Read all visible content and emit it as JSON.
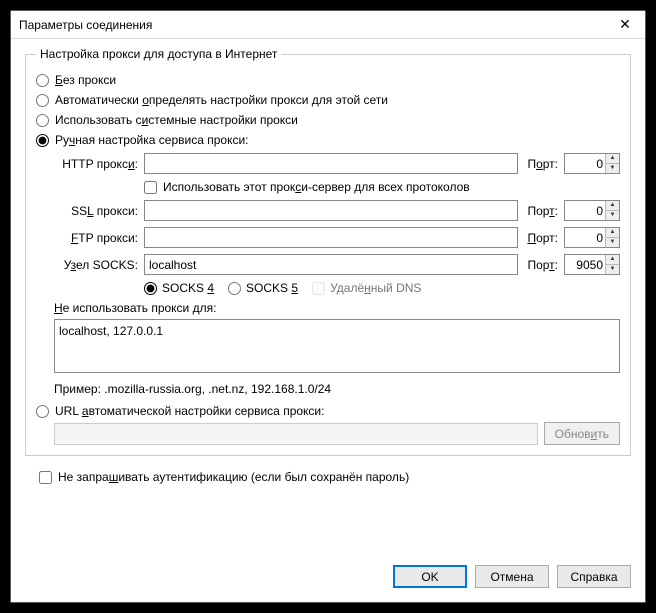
{
  "window": {
    "title": "Параметры соединения"
  },
  "group": {
    "legend": "Настройка прокси для доступа в Интернет"
  },
  "radios": {
    "none_pre": "",
    "none_u": "Б",
    "none_post": "ез прокси",
    "auto_pre": "Автоматически ",
    "auto_u": "о",
    "auto_post": "пределять настройки прокси для этой сети",
    "sys_pre": "Использовать с",
    "sys_u": "и",
    "sys_post": "стемные настройки прокси",
    "manual_pre": "Ру",
    "manual_u": "ч",
    "manual_post": "ная настройка сервиса прокси:"
  },
  "labels": {
    "http_pre": "HTTP прокс",
    "http_u": "и",
    "http_post": ":",
    "ssl_pre": "SS",
    "ssl_u": "L",
    "ssl_post": " прокси:",
    "ftp_pre": "",
    "ftp_u": "F",
    "ftp_post": "TP прокси:",
    "socks_pre": "У",
    "socks_u": "з",
    "socks_post": "ел SOCKS:",
    "port_pre": "П",
    "port_u": "о",
    "port_post": "рт:",
    "port2_pre": "Пор",
    "port2_u": "т",
    "port2_post": ":",
    "port3_pre": "",
    "port3_u": "П",
    "port3_post": "орт:",
    "port4_pre": "Пор",
    "port4_u": "т",
    "port4_post": ":"
  },
  "values": {
    "http_host": "",
    "http_port": "0",
    "ssl_host": "",
    "ssl_port": "0",
    "ftp_host": "",
    "ftp_port": "0",
    "socks_host": "localhost",
    "socks_port": "9050"
  },
  "share": {
    "pre": "Использовать этот прок",
    "u": "с",
    "post": "и-сервер для всех протоколов"
  },
  "socks": {
    "v4_pre": "SOCKS ",
    "v4_u": "4",
    "v5_pre": "SOCKS ",
    "v5_u": "5",
    "dns_pre": "Удалё",
    "dns_u": "н",
    "dns_post": "ный DNS"
  },
  "noproxy": {
    "label_pre": "",
    "label_u": "Н",
    "label_post": "е использовать прокси для:",
    "value": "localhost, 127.0.0.1",
    "example": "Пример: .mozilla-russia.org, .net.nz, 192.168.1.0/24"
  },
  "pac": {
    "pre": "URL ",
    "u": "а",
    "post": "втоматической настройки сервиса прокси:",
    "value": "",
    "reload_pre": "Обнов",
    "reload_u": "и",
    "reload_post": "ть"
  },
  "noauth": {
    "pre": "Не запра",
    "u": "ш",
    "post": "ивать аутентификацию (если был сохранён пароль)"
  },
  "buttons": {
    "ok": "OK",
    "cancel": "Отмена",
    "help": "Справка"
  }
}
